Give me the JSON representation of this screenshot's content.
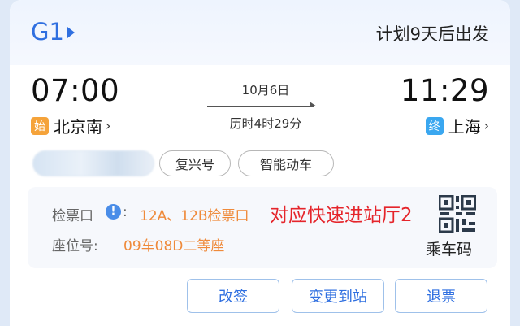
{
  "header": {
    "train_number": "G1",
    "plan_text": "计划9天后出发"
  },
  "departure": {
    "time": "07:00",
    "tag": "始",
    "station": "北京南",
    "chevron": "›"
  },
  "arrival": {
    "time": "11:29",
    "tag": "终",
    "station": "上海",
    "chevron": "›"
  },
  "trip": {
    "date": "10月6日",
    "duration": "历时4时29分"
  },
  "tags": [
    "复兴号",
    "智能动车"
  ],
  "info": {
    "gate_label": "检票口",
    "gate_icon": "!",
    "colon": ":",
    "gate_value": "12A、12B检票口",
    "seat_label": "座位号:",
    "seat_value": "09车08D二等座",
    "annotation": "对应快速进站厅2",
    "qr_label": "乘车码"
  },
  "actions": {
    "change": "改签",
    "change_station": "变更到站",
    "refund": "退票"
  },
  "colors": {
    "accent": "#2f6fe0",
    "orange": "#ef8a3a",
    "red_annotation": "#e5252b",
    "start_tag": "#f5a33a",
    "end_tag": "#3aa7f0"
  },
  "icons": {
    "play": "play-triangle-icon",
    "info": "info-icon",
    "qr": "qr-code-icon"
  }
}
